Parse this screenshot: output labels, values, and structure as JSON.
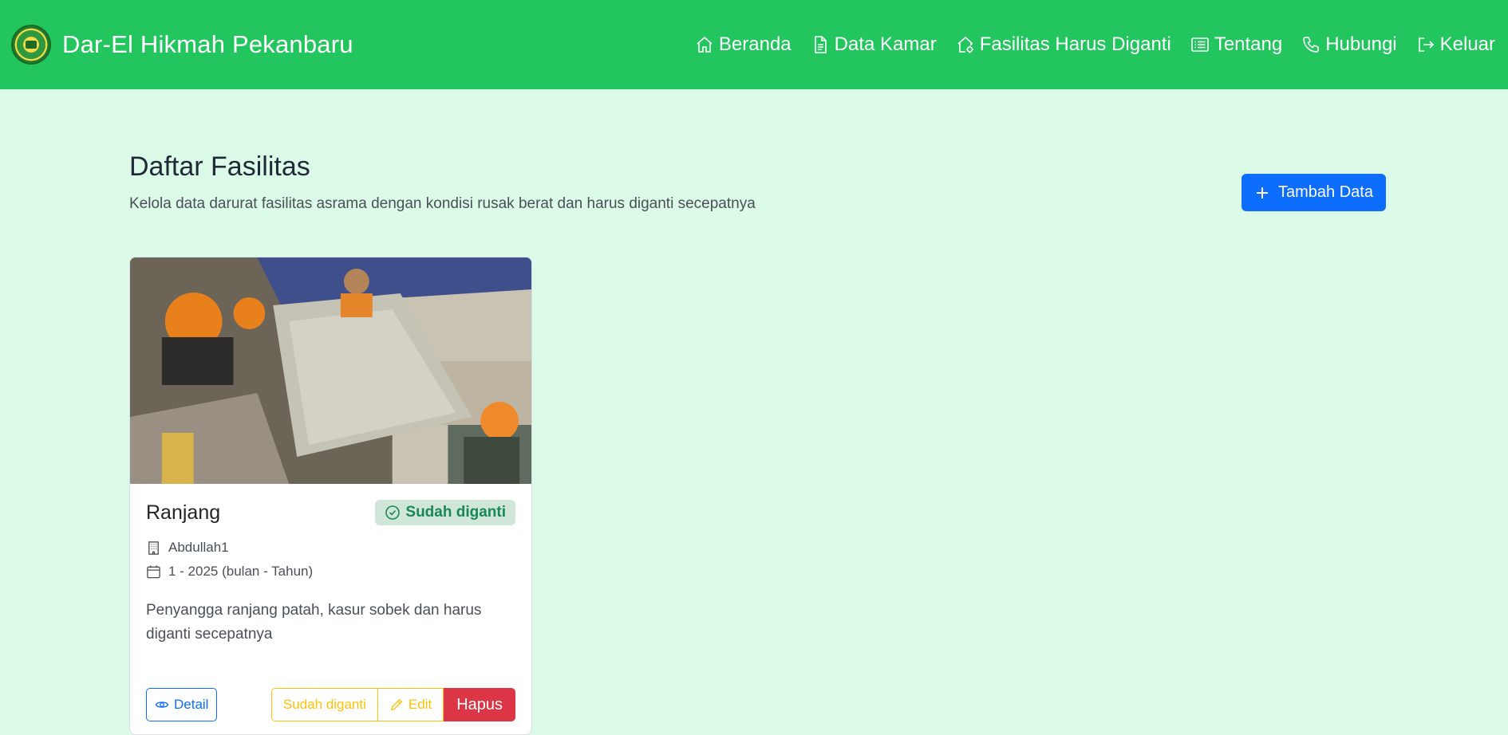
{
  "navbar": {
    "brand": "Dar-El Hikmah Pekanbaru",
    "items": [
      {
        "label": "Beranda",
        "icon": "home-icon"
      },
      {
        "label": "Data Kamar",
        "icon": "document-icon"
      },
      {
        "label": "Fasilitas Harus Diganti",
        "icon": "house-gear-icon"
      },
      {
        "label": "Tentang",
        "icon": "list-icon"
      },
      {
        "label": "Hubungi",
        "icon": "phone-icon"
      },
      {
        "label": "Keluar",
        "icon": "logout-icon"
      }
    ]
  },
  "page": {
    "title": "Daftar Fasilitas",
    "subtitle": "Kelola data darurat fasilitas asrama dengan kondisi rusak berat dan harus diganti secepatnya",
    "add_button": "Tambah Data"
  },
  "card": {
    "title": "Ranjang",
    "status": "Sudah diganti",
    "room": "Abdullah1",
    "period": "1 - 2025 (bulan - Tahun)",
    "description": "Penyangga ranjang patah, kasur sobek dan harus diganti secepatnya",
    "actions": {
      "detail": "Detail",
      "mark_replaced": "Sudah diganti",
      "edit": "Edit",
      "delete": "Hapus"
    }
  },
  "colors": {
    "navbar": "#22c55e",
    "background": "#dcfae8",
    "primary": "#0d6efd",
    "success": "#198754",
    "warning": "#ffc107",
    "danger": "#dc3545"
  }
}
